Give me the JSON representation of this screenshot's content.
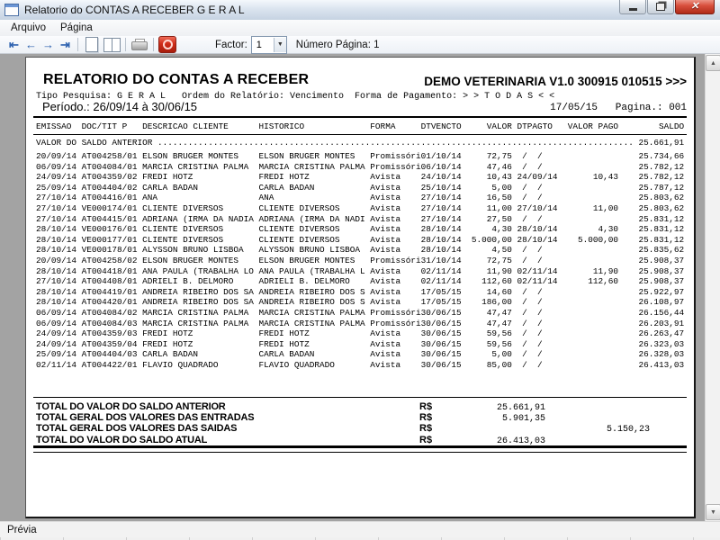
{
  "window": {
    "title": "Relatorio do CONTAS A RECEBER G E R A L"
  },
  "menu": {
    "items": [
      "Arquivo",
      "Página"
    ]
  },
  "toolbar": {
    "icons": [
      "first-page",
      "previous-page",
      "next-page",
      "last-page",
      "single-page-view",
      "two-page-view",
      "print",
      "close-preview"
    ],
    "factor_label": "Factor:",
    "factor_value": "1",
    "page_number_label": "Número Página: 1"
  },
  "colors": {
    "toolbar_arrow": "#2f63b0",
    "close_button": "#b02b18",
    "preview_background": "#a3a3a3"
  },
  "report": {
    "title": "RELATORIO DO CONTAS A RECEBER",
    "demo": "DEMO VETERINARIA V1.0 300915 010515 >>>",
    "filters": "Tipo Pesquisa: G E R A L   Ordem do Relatório: Vencimento  Forma de Pagamento: > > T O D A S < <",
    "period": "Período.: 26/09/14 à 30/06/15",
    "date_page": "17/05/15   Pagina.: 001",
    "columns": [
      "EMISSAO",
      "DOC/TIT P",
      "DESCRICAO CLIENTE",
      "HISTORICO",
      "FORMA",
      "DTVENCTO",
      "VALOR",
      "DTPAGTO",
      "VALOR PAGO",
      "SALDO"
    ],
    "saldo_anterior_label": "VALOR DO SALDO ANTERIOR",
    "saldo_anterior_value": "25.661,91",
    "rows": [
      {
        "emissao": "20/09/14",
        "doc": "AT004258/01",
        "cliente": "ELSON BRUGER MONTES",
        "historico": "ELSON BRUGER MONTES",
        "forma": "Promissóri",
        "dtvencto": "01/10/14",
        "valor": "72,75",
        "dtpagto": " /  /",
        "pago": "",
        "saldo": "25.734,66"
      },
      {
        "emissao": "06/09/14",
        "doc": "AT004084/01",
        "cliente": "MARCIA CRISTINA PALMA",
        "historico": "MARCIA CRISTINA PALMA",
        "forma": "Promissóri",
        "dtvencto": "06/10/14",
        "valor": "47,46",
        "dtpagto": " /  /",
        "pago": "",
        "saldo": "25.782,12"
      },
      {
        "emissao": "24/09/14",
        "doc": "AT004359/02",
        "cliente": "FREDI HOTZ",
        "historico": "FREDI HOTZ",
        "forma": "Avista",
        "dtvencto": "24/10/14",
        "valor": "10,43",
        "dtpagto": "24/09/14",
        "pago": "10,43",
        "saldo": "25.782,12"
      },
      {
        "emissao": "25/09/14",
        "doc": "AT004404/02",
        "cliente": "CARLA BADAN",
        "historico": "CARLA BADAN",
        "forma": "Avista",
        "dtvencto": "25/10/14",
        "valor": "5,00",
        "dtpagto": " /  /",
        "pago": "",
        "saldo": "25.787,12"
      },
      {
        "emissao": "27/10/14",
        "doc": "AT004416/01",
        "cliente": "ANA",
        "historico": "ANA",
        "forma": "Avista",
        "dtvencto": "27/10/14",
        "valor": "16,50",
        "dtpagto": " /  /",
        "pago": "",
        "saldo": "25.803,62"
      },
      {
        "emissao": "27/10/14",
        "doc": "VE000174/01",
        "cliente": "CLIENTE DIVERSOS",
        "historico": "CLIENTE DIVERSOS",
        "forma": "Avista",
        "dtvencto": "27/10/14",
        "valor": "11,00",
        "dtpagto": "27/10/14",
        "pago": "11,00",
        "saldo": "25.803,62"
      },
      {
        "emissao": "27/10/14",
        "doc": "AT004415/01",
        "cliente": "ADRIANA (IRMA DA NADIA",
        "historico": "ADRIANA (IRMA DA NADI",
        "forma": "Avista",
        "dtvencto": "27/10/14",
        "valor": "27,50",
        "dtpagto": " /  /",
        "pago": "",
        "saldo": "25.831,12"
      },
      {
        "emissao": "28/10/14",
        "doc": "VE000176/01",
        "cliente": "CLIENTE DIVERSOS",
        "historico": "CLIENTE DIVERSOS",
        "forma": "Avista",
        "dtvencto": "28/10/14",
        "valor": "4,30",
        "dtpagto": "28/10/14",
        "pago": "4,30",
        "saldo": "25.831,12"
      },
      {
        "emissao": "28/10/14",
        "doc": "VE000177/01",
        "cliente": "CLIENTE DIVERSOS",
        "historico": "CLIENTE DIVERSOS",
        "forma": "Avista",
        "dtvencto": "28/10/14",
        "valor": "5.000,00",
        "dtpagto": "28/10/14",
        "pago": "5.000,00",
        "saldo": "25.831,12"
      },
      {
        "emissao": "28/10/14",
        "doc": "VE000178/01",
        "cliente": "ALYSSON BRUNO LISBOA",
        "historico": "ALYSSON BRUNO LISBOA",
        "forma": "Avista",
        "dtvencto": "28/10/14",
        "valor": "4,50",
        "dtpagto": " /  /",
        "pago": "",
        "saldo": "25.835,62"
      },
      {
        "emissao": "20/09/14",
        "doc": "AT004258/02",
        "cliente": "ELSON BRUGER MONTES",
        "historico": "ELSON BRUGER MONTES",
        "forma": "Promissóri",
        "dtvencto": "31/10/14",
        "valor": "72,75",
        "dtpagto": " /  /",
        "pago": "",
        "saldo": "25.908,37"
      },
      {
        "emissao": "28/10/14",
        "doc": "AT004418/01",
        "cliente": "ANA PAULA (TRABALHA LO",
        "historico": "ANA PAULA (TRABALHA L",
        "forma": "Avista",
        "dtvencto": "02/11/14",
        "valor": "11,90",
        "dtpagto": "02/11/14",
        "pago": "11,90",
        "saldo": "25.908,37"
      },
      {
        "emissao": "27/10/14",
        "doc": "AT004408/01",
        "cliente": "ADRIELI B. DELMORO",
        "historico": "ADRIELI B. DELMORO",
        "forma": "Avista",
        "dtvencto": "02/11/14",
        "valor": "112,60",
        "dtpagto": "02/11/14",
        "pago": "112,60",
        "saldo": "25.908,37"
      },
      {
        "emissao": "28/10/14",
        "doc": "AT004419/01",
        "cliente": "ANDREIA RIBEIRO DOS SA",
        "historico": "ANDREIA RIBEIRO DOS S",
        "forma": "Avista",
        "dtvencto": "17/05/15",
        "valor": "14,60",
        "dtpagto": " /  /",
        "pago": "",
        "saldo": "25.922,97"
      },
      {
        "emissao": "28/10/14",
        "doc": "AT004420/01",
        "cliente": "ANDREIA RIBEIRO DOS SA",
        "historico": "ANDREIA RIBEIRO DOS S",
        "forma": "Avista",
        "dtvencto": "17/05/15",
        "valor": "186,00",
        "dtpagto": " /  /",
        "pago": "",
        "saldo": "26.108,97"
      },
      {
        "emissao": "06/09/14",
        "doc": "AT004084/02",
        "cliente": "MARCIA CRISTINA PALMA",
        "historico": "MARCIA CRISTINA PALMA",
        "forma": "Promissóri",
        "dtvencto": "30/06/15",
        "valor": "47,47",
        "dtpagto": " /  /",
        "pago": "",
        "saldo": "26.156,44"
      },
      {
        "emissao": "06/09/14",
        "doc": "AT004084/03",
        "cliente": "MARCIA CRISTINA PALMA",
        "historico": "MARCIA CRISTINA PALMA",
        "forma": "Promissóri",
        "dtvencto": "30/06/15",
        "valor": "47,47",
        "dtpagto": " /  /",
        "pago": "",
        "saldo": "26.203,91"
      },
      {
        "emissao": "24/09/14",
        "doc": "AT004359/03",
        "cliente": "FREDI HOTZ",
        "historico": "FREDI HOTZ",
        "forma": "Avista",
        "dtvencto": "30/06/15",
        "valor": "59,56",
        "dtpagto": " /  /",
        "pago": "",
        "saldo": "26.263,47"
      },
      {
        "emissao": "24/09/14",
        "doc": "AT004359/04",
        "cliente": "FREDI HOTZ",
        "historico": "FREDI HOTZ",
        "forma": "Avista",
        "dtvencto": "30/06/15",
        "valor": "59,56",
        "dtpagto": " /  /",
        "pago": "",
        "saldo": "26.323,03"
      },
      {
        "emissao": "25/09/14",
        "doc": "AT004404/03",
        "cliente": "CARLA BADAN",
        "historico": "CARLA BADAN",
        "forma": "Avista",
        "dtvencto": "30/06/15",
        "valor": "5,00",
        "dtpagto": " /  /",
        "pago": "",
        "saldo": "26.328,03"
      },
      {
        "emissao": "02/11/14",
        "doc": "AT004422/01",
        "cliente": "FLAVIO QUADRADO",
        "historico": "FLAVIO QUADRADO",
        "forma": "Avista",
        "dtvencto": "30/06/15",
        "valor": "85,00",
        "dtpagto": " /  /",
        "pago": "",
        "saldo": "26.413,03"
      }
    ],
    "totals": [
      {
        "label": "TOTAL DO VALOR DO SALDO ANTERIOR",
        "currency": "R$",
        "value": "25.661,91",
        "value2": ""
      },
      {
        "label": "TOTAL GERAL DOS VALORES DAS ENTRADAS",
        "currency": "R$",
        "value": "5.901,35",
        "value2": ""
      },
      {
        "label": "TOTAL GERAL DOS VALORES DAS SAIDAS",
        "currency": "R$",
        "value": "",
        "value2": "5.150,23"
      },
      {
        "label": "TOTAL DO VALOR DO SALDO ATUAL",
        "currency": "R$",
        "value": "26.413,03",
        "value2": ""
      }
    ]
  },
  "status": {
    "text": "Prévia"
  }
}
